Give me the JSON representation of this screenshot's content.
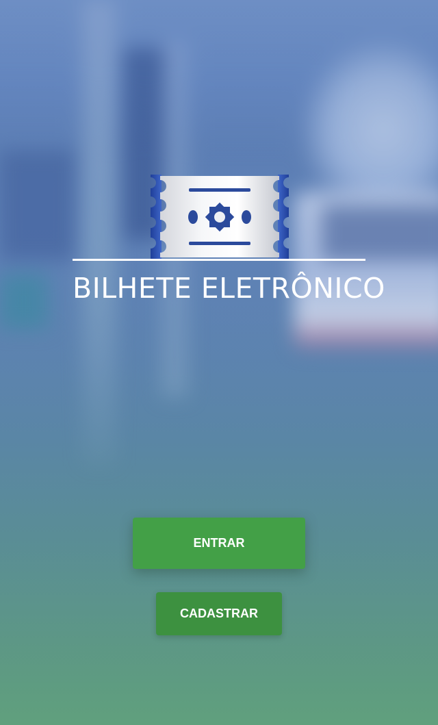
{
  "app": {
    "brand_name": "BILHETE ELETRÔNICO"
  },
  "logo": {
    "icon": "ticket-icon"
  },
  "actions": {
    "login_label": "ENTRAR",
    "register_label": "CADASTRAR"
  },
  "colors": {
    "primary_button": "#43a047",
    "secondary_button": "#3d9140",
    "text": "#ffffff"
  }
}
